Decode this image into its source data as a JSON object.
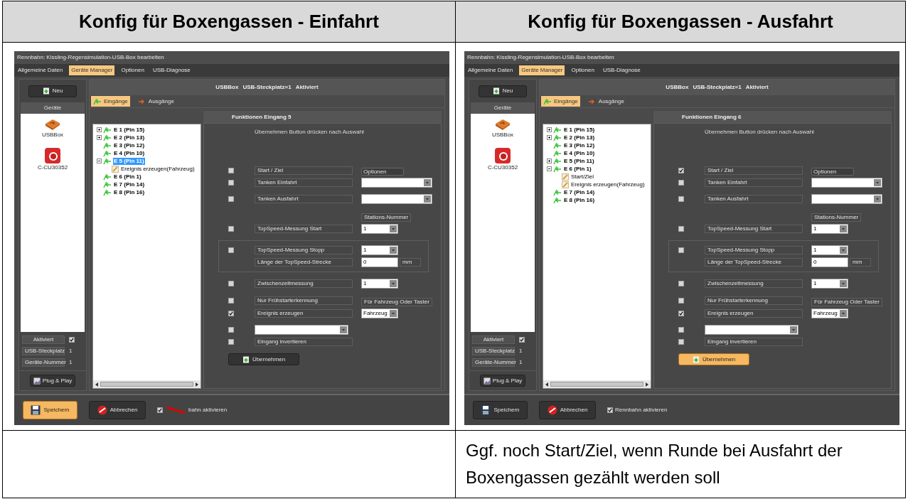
{
  "table": {
    "headers": [
      "Konfig für Boxengassen - Einfahrt",
      "Konfig für Boxengassen - Ausfahrt"
    ],
    "panels": [
      {
        "title": "Rennbahn: Kissling-Regensimulation-USB-Box bearbeiten",
        "menu": [
          {
            "label": "Allgemeine Daten",
            "selected": false
          },
          {
            "label": "Geräte Manager",
            "selected": true
          },
          {
            "label": "Optionen",
            "selected": false
          },
          {
            "label": "USB-Diagnose",
            "selected": false
          }
        ],
        "new_button": "Neu",
        "devices_header": "Geräte",
        "devices": [
          {
            "label": "USBBox",
            "kind": "usb"
          },
          {
            "label": "C-CU30352",
            "kind": "cu"
          }
        ],
        "active": {
          "label": "Aktiviert",
          "checked": true
        },
        "info": [
          {
            "label": "USB-Steckplatz",
            "value": "1"
          },
          {
            "label": "Geräte-Nummer",
            "value": "1"
          }
        ],
        "plug_button": "Plug & Play",
        "status": [
          "USBBox",
          "USB-Steckplatz=1",
          "Aktiviert"
        ],
        "tabs": [
          {
            "label": "Eingänge",
            "selected": true,
            "kind": "in"
          },
          {
            "label": "Ausgänge",
            "selected": false,
            "kind": "out"
          }
        ],
        "tree": [
          {
            "label": "E 1 (Pin 15)",
            "expanded": false,
            "selected": false,
            "kind": "input"
          },
          {
            "label": "E 2 (Pin 13)",
            "expanded": false,
            "selected": false,
            "kind": "input"
          },
          {
            "label": "E 3 (Pin 12)",
            "selected": false,
            "kind": "input"
          },
          {
            "label": "E 4 (Pin 10)",
            "selected": false,
            "kind": "input"
          },
          {
            "label": "E 5 (Pin 11)",
            "expanded": true,
            "selected": true,
            "kind": "input",
            "children": [
              {
                "label": "Ereignis erzeugen(Fahrzeug)",
                "selected": false,
                "kind": "event"
              }
            ]
          },
          {
            "label": "E 6 (Pin 1)",
            "selected": false,
            "kind": "input"
          },
          {
            "label": "E 7 (Pin 14)",
            "selected": false,
            "kind": "input"
          },
          {
            "label": "E 8 (Pin 16)",
            "selected": false,
            "kind": "input"
          }
        ],
        "functions_title": "Funktionen Eingang 5",
        "hint": "Übernehmen Button drücken nach Auswahl",
        "groups": [
          {
            "framed": false,
            "rows": [
              {
                "checked": false,
                "label": "Start / Ziel",
                "side": {
                  "kind": "button",
                  "text": "Optionen"
                }
              },
              {
                "checked": false,
                "label": "Tanken Einfahrt",
                "side": {
                  "kind": "select"
                }
              }
            ]
          },
          {
            "framed": false,
            "rows": [
              {
                "checked": false,
                "label": "Tanken Ausfahrt",
                "side": {
                  "kind": "select"
                }
              }
            ]
          },
          {
            "framed": false,
            "rows": [
              {
                "side": {
                  "kind": "caption",
                  "text": "Stations-Nummer"
                }
              },
              {
                "checked": false,
                "label": "TopSpeed-Messung Start",
                "side": {
                  "kind": "small_select",
                  "text": "1"
                }
              }
            ]
          },
          {
            "framed": true,
            "rows": [
              {
                "checked": false,
                "label": "TopSpeed-Messung Stopp",
                "side": {
                  "kind": "small_select",
                  "text": "1"
                }
              },
              {
                "label": "Länge der TopSpeed-Strecke",
                "side": {
                  "kind": "input",
                  "text": "0",
                  "unit": "mm"
                }
              }
            ]
          },
          {
            "framed": false,
            "rows": [
              {
                "checked": false,
                "label": "Zwischenzeitmessung",
                "side": {
                  "kind": "small_select",
                  "text": "1"
                }
              }
            ]
          },
          {
            "framed": false,
            "rows": [
              {
                "checked": false,
                "label": "Nur Frühstarterkennung",
                "side": {
                  "kind": "caption",
                  "text": "Für Fahrzeug Oder Taster"
                }
              },
              {
                "checked": true,
                "label": "Ereignis erzeugen",
                "side": {
                  "kind": "small_select",
                  "text": "Fahrzeug"
                }
              }
            ]
          },
          {
            "framed": false,
            "rows": [
              {
                "checked": false,
                "wide_select": true
              },
              {
                "checked": false,
                "label": "Eingang invertieren"
              }
            ]
          }
        ],
        "apply_button": {
          "label": "Übernehmen",
          "highlighted": false
        },
        "save_button": {
          "label": "Speichern",
          "highlighted": true
        },
        "cancel_button": "Abbrechen",
        "track_checkbox": {
          "label": "bahn aktivieren",
          "checked": true,
          "marker": true
        }
      },
      {
        "title": "Rennbahn: Kissling-Regensimulation-USB-Box bearbeiten",
        "menu": [
          {
            "label": "Allgemeine Daten",
            "selected": false
          },
          {
            "label": "Geräte Manager",
            "selected": true
          },
          {
            "label": "Optionen",
            "selected": false
          },
          {
            "label": "USB-Diagnose",
            "selected": false
          }
        ],
        "new_button": "Neu",
        "devices_header": "Geräte",
        "devices": [
          {
            "label": "USBBox",
            "kind": "usb"
          },
          {
            "label": "C-CU30352",
            "kind": "cu"
          }
        ],
        "active": {
          "label": "Aktiviert",
          "checked": true
        },
        "info": [
          {
            "label": "USB-Steckplatz",
            "value": "1"
          },
          {
            "label": "Geräte-Nummer",
            "value": "1"
          }
        ],
        "plug_button": "Plug & Play",
        "status": [
          "USBBox",
          "USB-Steckplatz=1",
          "Aktiviert"
        ],
        "tabs": [
          {
            "label": "Eingänge",
            "selected": true,
            "kind": "in"
          },
          {
            "label": "Ausgänge",
            "selected": false,
            "kind": "out"
          }
        ],
        "tree": [
          {
            "label": "E 1 (Pin 15)",
            "expanded": false,
            "selected": false,
            "kind": "input"
          },
          {
            "label": "E 2 (Pin 13)",
            "expanded": false,
            "selected": false,
            "kind": "input"
          },
          {
            "label": "E 3 (Pin 12)",
            "selected": false,
            "kind": "input"
          },
          {
            "label": "E 4 (Pin 10)",
            "selected": false,
            "kind": "input"
          },
          {
            "label": "E 5 (Pin 11)",
            "expanded": false,
            "selected": false,
            "kind": "input"
          },
          {
            "label": "E 6 (Pin 1)",
            "expanded": true,
            "selected": false,
            "kind": "input",
            "children": [
              {
                "label": "Start/Ziel",
                "selected": false,
                "kind": "event"
              },
              {
                "label": "Ereignis erzeugen(Fahrzeug)",
                "selected": false,
                "kind": "event"
              }
            ]
          },
          {
            "label": "E 7 (Pin 14)",
            "selected": false,
            "kind": "input"
          },
          {
            "label": "E 8 (Pin 16)",
            "selected": false,
            "kind": "input"
          }
        ],
        "functions_title": "Funktionen Eingang 6",
        "hint": "Übernehmen Button drücken nach Auswahl",
        "groups": [
          {
            "framed": false,
            "rows": [
              {
                "checked": true,
                "label": "Start / Ziel",
                "side": {
                  "kind": "button",
                  "text": "Optionen"
                }
              },
              {
                "checked": false,
                "label": "Tanken Einfahrt",
                "side": {
                  "kind": "select"
                }
              }
            ]
          },
          {
            "framed": false,
            "rows": [
              {
                "checked": false,
                "label": "Tanken Ausfahrt",
                "side": {
                  "kind": "select"
                }
              }
            ]
          },
          {
            "framed": false,
            "rows": [
              {
                "side": {
                  "kind": "caption",
                  "text": "Stations-Nummer"
                }
              },
              {
                "checked": false,
                "label": "TopSpeed-Messung Start",
                "side": {
                  "kind": "small_select",
                  "text": "1"
                }
              }
            ]
          },
          {
            "framed": true,
            "rows": [
              {
                "checked": false,
                "label": "TopSpeed-Messung Stopp",
                "side": {
                  "kind": "small_select",
                  "text": "1"
                }
              },
              {
                "label": "Länge der TopSpeed-Strecke",
                "side": {
                  "kind": "input",
                  "text": "0",
                  "unit": "mm"
                }
              }
            ]
          },
          {
            "framed": false,
            "rows": [
              {
                "checked": false,
                "label": "Zwischenzeitmessung",
                "side": {
                  "kind": "small_select",
                  "text": "1"
                }
              }
            ]
          },
          {
            "framed": false,
            "rows": [
              {
                "checked": false,
                "label": "Nur Frühstarterkennung",
                "side": {
                  "kind": "caption",
                  "text": "Für Fahrzeug Oder Taster"
                }
              },
              {
                "checked": true,
                "label": "Ereignis erzeugen",
                "side": {
                  "kind": "small_select",
                  "text": "Fahrzeug"
                }
              }
            ]
          },
          {
            "framed": false,
            "rows": [
              {
                "checked": false,
                "wide_select": true
              },
              {
                "checked": false,
                "label": "Eingang invertieren"
              }
            ]
          }
        ],
        "apply_button": {
          "label": "Übernehmen",
          "highlighted": true
        },
        "save_button": {
          "label": "Speichern",
          "highlighted": false
        },
        "cancel_button": "Abbrechen",
        "track_checkbox": {
          "label": "Rennbahn aktivieren",
          "checked": true,
          "marker": false
        }
      }
    ],
    "note": "Ggf. noch Start/Ziel, wenn Runde bei Ausfahrt der Boxengassen gezählt werden soll"
  }
}
